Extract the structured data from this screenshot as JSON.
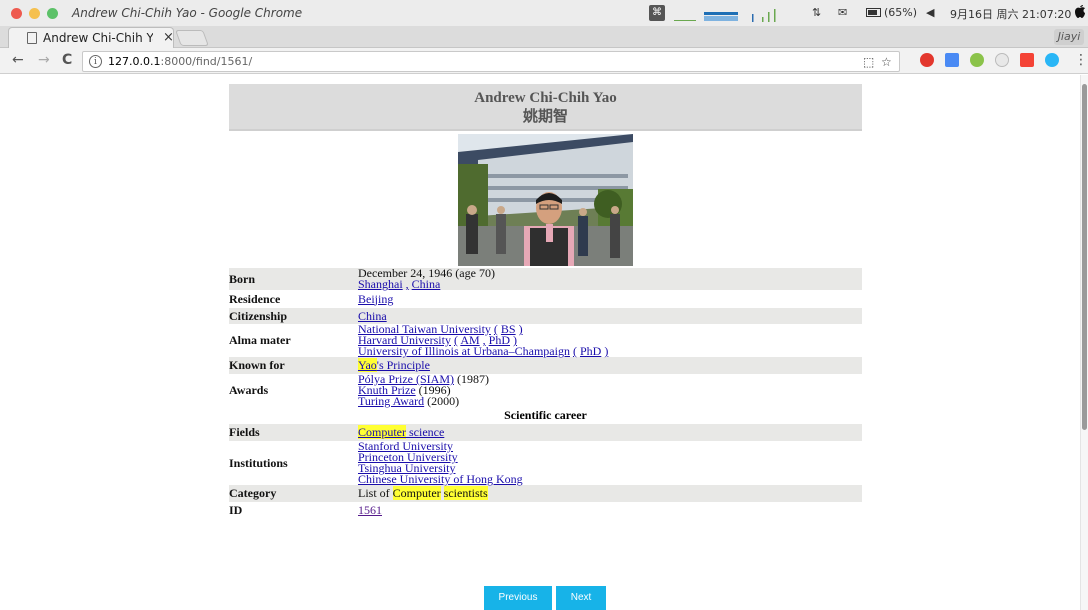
{
  "os_bar": {
    "window_title": "Andrew Chi-Chih Yao - Google Chrome",
    "cmd_key": "⌘",
    "wifi_arrows": "⇅",
    "mail_icon": "✉",
    "battery": "(65%)",
    "volume": "◀",
    "datetime": "9月16日 周六 21:07:20"
  },
  "browser": {
    "tab_title": "Andrew Chi-Chih Yao",
    "tab_close": "×",
    "profile_name": "Jiayi",
    "back": "←",
    "forward": "→",
    "reload": "C",
    "info": "i",
    "url_host": "127.0.0.1",
    "url_rest": ":8000/find/1561/",
    "translate_icon": "⬚",
    "star_icon": "☆",
    "menu_icon": "⋮"
  },
  "person": {
    "name_en": "Andrew Chi-Chih Yao",
    "name_zh": "姚期智"
  },
  "rows": {
    "born": {
      "label": "Born",
      "date": "December 24, 1946 (age 70)",
      "city": "Shanghai",
      "sep": ",",
      "country": "China"
    },
    "residence": {
      "label": "Residence",
      "value": "Beijing"
    },
    "citizenship": {
      "label": "Citizenship",
      "value": "China"
    },
    "alma_mater": {
      "label": "Alma mater",
      "l1_school": "National Taiwan University",
      "l1_open": "(",
      "l1_degree": "BS",
      "l1_close": ")",
      "l2_school": "Harvard University",
      "l2_open": "(",
      "l2_degree1": "AM",
      "l2_sep": ",",
      "l2_degree2": "PhD",
      "l2_close": ")",
      "l3_school": "University of Illinois at Urbana–Champaign",
      "l3_open": "(",
      "l3_degree": "PhD",
      "l3_close": ")"
    },
    "known_for": {
      "label": "Known for",
      "hl": "Yao",
      "rest": "'s Principle"
    },
    "awards": {
      "label": "Awards",
      "a1": "Pólya Prize (SIAM)",
      "a1_year": "(1987)",
      "a2": "Knuth Prize",
      "a2_year": "(1996)",
      "a3": "Turing Award",
      "a3_year": "(2000)"
    },
    "section_title": "Scientific career",
    "fields": {
      "label": "Fields",
      "hl": "Computer",
      "rest": "science"
    },
    "institutions": {
      "label": "Institutions",
      "i1": "Stanford University",
      "i2": "Princeton University",
      "i3": "Tsinghua University",
      "i4": "Chinese University of Hong Kong"
    },
    "category": {
      "label": "Category",
      "prefix": "List of",
      "hl1": "Computer",
      "hl2": "scientists"
    },
    "id": {
      "label": "ID",
      "value": "1561"
    }
  },
  "buttons": {
    "previous": "Previous",
    "next": "Next"
  },
  "colors": {
    "link": "#1a0dab",
    "highlight": "#ffff33",
    "button": "#17b3e8",
    "row_shade": "#e8e8e6",
    "header_bg": "#dcdcdc"
  }
}
